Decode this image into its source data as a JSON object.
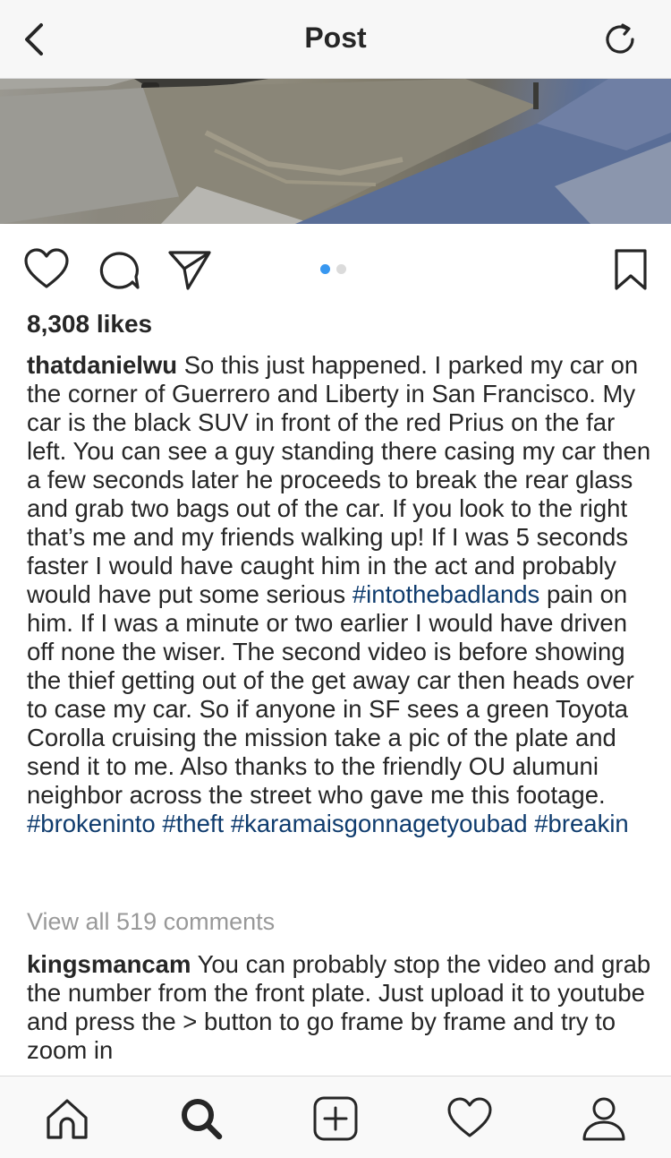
{
  "header": {
    "title": "Post",
    "back_icon": "chevron-left-icon",
    "refresh_icon": "refresh-icon"
  },
  "media": {
    "carousel_active_index": 0,
    "carousel_count": 2,
    "active_dot_color": "#3897f0",
    "inactive_dot_color": "#dbdbdb"
  },
  "post": {
    "likes": "8,308 likes",
    "caption": {
      "username": "thatdanielwu",
      "text_1": " So this just happened. I parked my car on the corner of Guerrero and Liberty in San Francisco. My car is the black SUV in front of the red Prius on the far left. You can see a guy standing there casing my car then a few seconds later he proceeds to break the rear glass and grab two bags out of the car. If you look to the right that’s me and my friends walking up! If I was 5 seconds faster I would have caught him in the act and probably would have put some serious ",
      "tag_1": "#intothebadlands",
      "text_2": " pain on him. If I was a minute or two earlier I would have driven off none the wiser. The second video is before showing the thief getting out of the get away car then heads over to case my car. So if anyone in SF sees a green Toyota Corolla cruising the mission take a pic of the plate and send it to me. Also thanks to the friendly OU alumuni neighbor across the street who gave me this footage. ",
      "tag_2": "#brokeninto",
      "tag_3": "#theft",
      "tag_4": "#karamaisgonnagetyoubad",
      "tag_5": "#breakin"
    },
    "view_all_comments": "View all 519 comments",
    "comment": {
      "username": "kingsmancam",
      "text": " You can probably stop the video and grab the number from the front plate. Just upload it to youtube and press the > button to go frame by frame and try to zoom in"
    }
  },
  "bottom_nav": {
    "items": [
      "home-icon",
      "search-icon",
      "add-post-icon",
      "activity-heart-icon",
      "profile-icon"
    ]
  },
  "colors": {
    "hashtag": "#0f3c6e",
    "muted_text": "#999999",
    "text": "#262626"
  }
}
